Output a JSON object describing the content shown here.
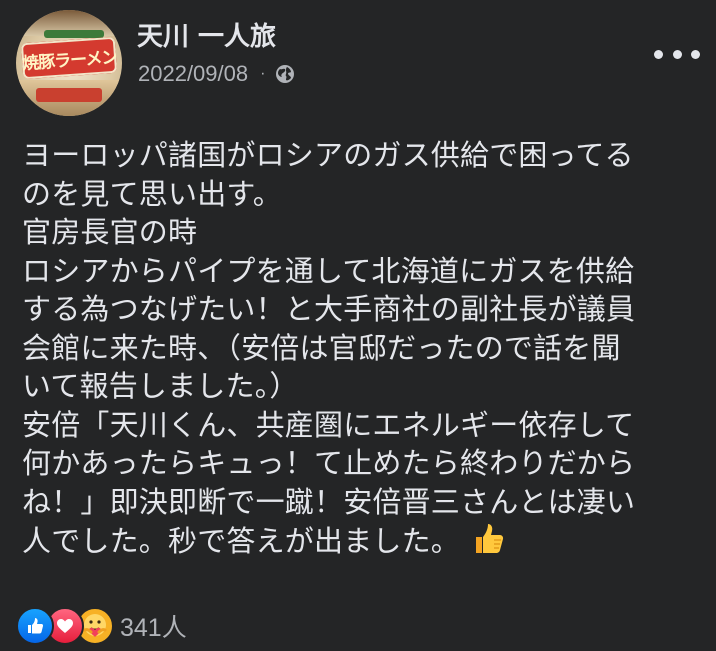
{
  "post": {
    "author": "天川 一人旅",
    "date": "2022/09/08",
    "separator": "·",
    "privacy_icon": "globe-icon",
    "menu_icon": "more-options-icon",
    "avatar_label": "焼豚ラーメン",
    "lines": [
      "ヨーロッパ諸国がロシアのガス供給で困ってる",
      "のを見て思い出す。",
      "官房長官の時",
      "ロシアからパイプを通して北海道にガスを供給",
      "する為つなげたい！と大手商社の副社長が議員",
      "会館に来た時、（安倍は官邸だったので話を聞",
      "いて報告しました。）",
      "安倍「天川くん、共産圏にエネルギー依存して",
      "何かあったらキュっ！て止めたら終わりだから",
      "ね！」即決即断で一蹴！安倍晋三さんとは凄い",
      "人でした。秒で答えが出ました。"
    ],
    "end_emoji": "thumbs-up-icon"
  },
  "reactions": {
    "icons": [
      "like-icon",
      "love-icon",
      "care-icon"
    ],
    "count": "341人"
  },
  "colors": {
    "background": "#242526",
    "text": "#e4e6eb",
    "secondary": "#b0b3b8"
  }
}
